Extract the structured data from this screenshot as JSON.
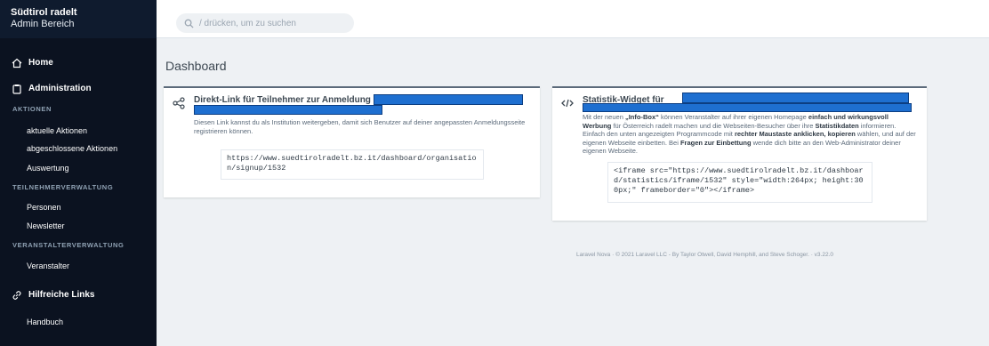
{
  "brand": {
    "title": "Südtirol radelt",
    "subtitle": "Admin Bereich"
  },
  "search": {
    "placeholder": "/ drücken, um zu suchen"
  },
  "nav": {
    "home": "Home",
    "administration": "Administration",
    "aktionen_section": "AKTIONEN",
    "aktuelle": "aktuelle Aktionen",
    "abgeschlossene": "abgeschlossene Aktionen",
    "auswertung": "Auswertung",
    "teilnehmer_section": "TEILNEHMERVERWALTUNG",
    "personen": "Personen",
    "newsletter": "Newsletter",
    "veranstalter_section": "VERANSTALTERVERWALTUNG",
    "veranstalter": "Veranstalter",
    "links": "Hilfreiche Links",
    "handbuch": "Handbuch"
  },
  "page": {
    "title": "Dashboard"
  },
  "card_link": {
    "title": "Direkt-Link für Teilnehmer zur Anmeldung",
    "desc": "Diesen Link kannst du als Institution weitergeben, damit sich Benutzer auf deiner angepassten Anmeldungsseite registrieren können.",
    "url": "https://www.suedtirolradelt.bz.it/dashboard/organisation/signup/1532"
  },
  "card_widget": {
    "title": "Statistik-Widget für",
    "p1": "Mit der neuen ",
    "b1": "„Info-Box“",
    "p2": " können Veranstalter auf ihrer eigenen Homepage ",
    "b2": "einfach und wirkungsvoll Werbung",
    "p3": " für Österreich radelt machen und die Webseiten-Besucher über ihre ",
    "b3": "Statistikdaten",
    "p4": " informieren. Einfach den unten angezeigten Programmcode mit ",
    "b4": "rechter Maustaste anklicken, kopieren",
    "p5": " wählen, und auf der eigenen Webseite einbetten. Bei ",
    "b5": "Fragen zur Einbettung",
    "p6": " wende dich bitte an den Web-Administrator deiner eigenen Webseite.",
    "code": "<iframe src=\"https://www.suedtirolradelt.bz.it/dashboard/statistics/iframe/1532\" style=\"width:264px; height:300px;\" frameborder=\"0\"></iframe>"
  },
  "footer": {
    "text": "Laravel Nova  ·  © 2021 Laravel LLC - By Taylor Otwell, David Hemphill, and Steve Schoger.  ·  v3.22.0"
  }
}
